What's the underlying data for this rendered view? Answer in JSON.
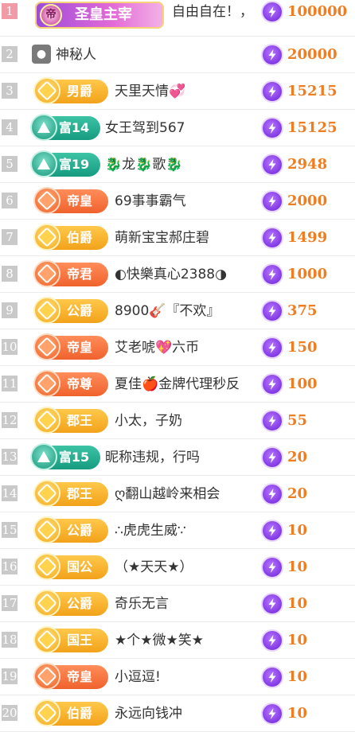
{
  "rows": [
    {
      "rank": "1",
      "badge_type": "special",
      "badge": "圣皇主宰",
      "badge_icon": "帝",
      "name": "自由自在！，",
      "score": "100000"
    },
    {
      "rank": "2",
      "badge_type": "avatar",
      "badge": "",
      "name": "神秘人",
      "score": "20000"
    },
    {
      "rank": "3",
      "badge_type": "gold",
      "badge": "男爵",
      "name": "天里天情💞",
      "score": "15215"
    },
    {
      "rank": "4",
      "badge_type": "green",
      "badge": "富14",
      "name": "女王驾到567",
      "score": "15125"
    },
    {
      "rank": "5",
      "badge_type": "green",
      "badge": "富19",
      "name": "🐉龙🐉歌🐉",
      "score": "2948"
    },
    {
      "rank": "6",
      "badge_type": "orange",
      "badge": "帝皇",
      "name": "69事事霸气",
      "score": "2000"
    },
    {
      "rank": "7",
      "badge_type": "gold",
      "badge": "伯爵",
      "name": "萌新宝宝郝庄碧",
      "score": "1499"
    },
    {
      "rank": "8",
      "badge_type": "orange",
      "badge": "帝君",
      "name": "◐快樂真心2388◑",
      "score": "1000"
    },
    {
      "rank": "9",
      "badge_type": "gold",
      "badge": "公爵",
      "name": "8900🎸『不欢』",
      "score": "375"
    },
    {
      "rank": "10",
      "badge_type": "orange",
      "badge": "帝皇",
      "name": "艾老唬💖六币",
      "score": "150"
    },
    {
      "rank": "11",
      "badge_type": "orange",
      "badge": "帝尊",
      "name": "夏佳🍎金牌代理秒反",
      "score": "100"
    },
    {
      "rank": "12",
      "badge_type": "gold",
      "badge": "郡王",
      "name": "小太，子奶",
      "score": "55"
    },
    {
      "rank": "13",
      "badge_type": "green",
      "badge": "富15",
      "name": "昵称违规，行吗",
      "score": "20"
    },
    {
      "rank": "14",
      "badge_type": "gold",
      "badge": "郡王",
      "name": "ღ翻山越岭来相会",
      "score": "20"
    },
    {
      "rank": "15",
      "badge_type": "gold",
      "badge": "公爵",
      "name": "∴虎虎生威∵",
      "score": "10"
    },
    {
      "rank": "16",
      "badge_type": "gold",
      "badge": "国公",
      "name": "（★天天★）",
      "score": "10"
    },
    {
      "rank": "17",
      "badge_type": "gold",
      "badge": "公爵",
      "name": "奇乐无言",
      "score": "10"
    },
    {
      "rank": "18",
      "badge_type": "gold",
      "badge": "国王",
      "name": "★个★微★笑★",
      "score": "10"
    },
    {
      "rank": "19",
      "badge_type": "orange",
      "badge": "帝皇",
      "name": "小逗逗!",
      "score": "10"
    },
    {
      "rank": "20",
      "badge_type": "gold",
      "badge": "伯爵",
      "name": "永远向钱冲",
      "score": "10"
    }
  ],
  "icons": {
    "score_icon": "lightning-coin-icon",
    "avatar_icon": "mystery-user-icon"
  },
  "colors": {
    "score": "#ef7d22",
    "gold_badge": "#f2a21a",
    "orange_badge": "#f0622c",
    "green_badge": "#169b80",
    "coin": "#6b21d9"
  }
}
